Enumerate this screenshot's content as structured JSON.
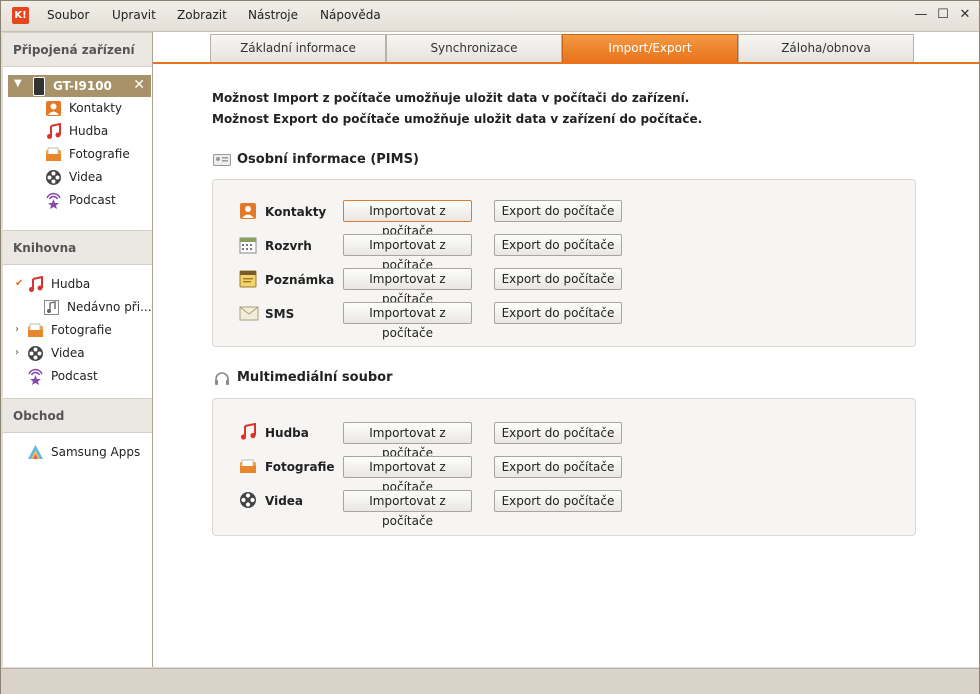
{
  "menu": {
    "app_icon_label": "K!",
    "items": [
      "Soubor",
      "Upravit",
      "Zobrazit",
      "Nástroje",
      "Nápověda"
    ]
  },
  "window_controls": {
    "minimize": "—",
    "maximize": "☐",
    "close": "✕"
  },
  "sidebar": {
    "connected_header": "Připojená zařízení",
    "device": {
      "name": "GT-I9100",
      "close": "✕"
    },
    "device_items": [
      "Kontakty",
      "Hudba",
      "Fotografie",
      "Videa",
      "Podcast"
    ],
    "library_header": "Knihovna",
    "library_items": [
      {
        "label": "Hudba",
        "expanded": true
      },
      {
        "label": "Nedávno při...",
        "child": true
      },
      {
        "label": "Fotografie",
        "expanded": false
      },
      {
        "label": "Videa",
        "expanded": false
      },
      {
        "label": "Podcast"
      }
    ],
    "shop_header": "Obchod",
    "shop_items": [
      "Samsung Apps"
    ]
  },
  "tabs": [
    {
      "label": "Základní informace",
      "active": false
    },
    {
      "label": "Synchronizace",
      "active": false
    },
    {
      "label": "Import/Export",
      "active": true
    },
    {
      "label": "Záloha/obnova",
      "active": false
    }
  ],
  "intro": {
    "line1": "Možnost Import z počítače umožňuje uložit data v počítači do zařízení.",
    "line2": "Možnost Export do počítače umožňuje uložit data v zařízení do počítače."
  },
  "pims": {
    "title": "Osobní informace (PIMS)",
    "rows": [
      "Kontakty",
      "Rozvrh",
      "Poznámka",
      "SMS"
    ]
  },
  "media": {
    "title": "Multimediální soubor",
    "rows": [
      "Hudba",
      "Fotografie",
      "Videa"
    ]
  },
  "buttons": {
    "import": "Importovat z počítače",
    "export": "Export do počítače"
  },
  "colors": {
    "accent": "#e8731c",
    "device_bg": "#a8926a"
  }
}
